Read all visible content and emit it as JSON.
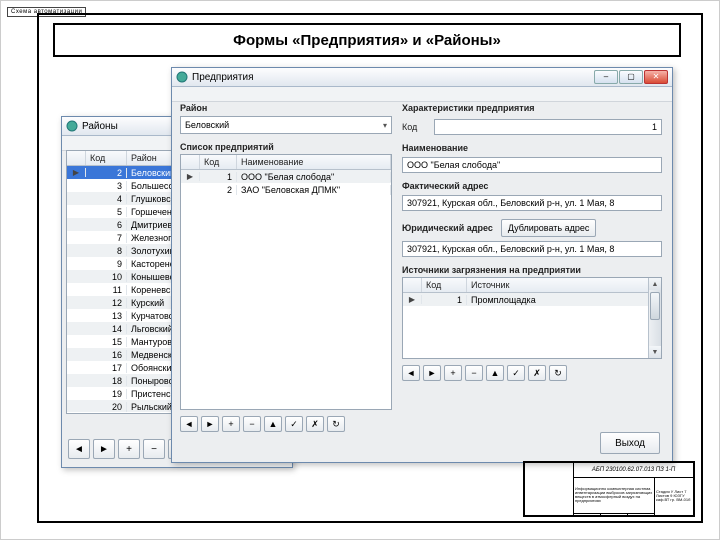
{
  "tag_text": "Схема автоматизации",
  "page_title": "Формы «Предприятия» и «Районы»",
  "window_districts": {
    "title": "Районы",
    "columns": [
      "Код",
      "Район"
    ],
    "rows": [
      {
        "code": 2,
        "name": "Беловский",
        "selected": true
      },
      {
        "code": 3,
        "name": "Большесолдатский"
      },
      {
        "code": 4,
        "name": "Глушковский"
      },
      {
        "code": 5,
        "name": "Горшеченский"
      },
      {
        "code": 6,
        "name": "Дмитриевский"
      },
      {
        "code": 7,
        "name": "Железногорский"
      },
      {
        "code": 8,
        "name": "Золотухинский"
      },
      {
        "code": 9,
        "name": "Касторенский"
      },
      {
        "code": 10,
        "name": "Конышевский"
      },
      {
        "code": 11,
        "name": "Кореневский"
      },
      {
        "code": 12,
        "name": "Курский"
      },
      {
        "code": 13,
        "name": "Курчатовский"
      },
      {
        "code": 14,
        "name": "Льговский"
      },
      {
        "code": 15,
        "name": "Мантуровский"
      },
      {
        "code": 16,
        "name": "Медвенский"
      },
      {
        "code": 17,
        "name": "Обоянский"
      },
      {
        "code": 18,
        "name": "Поныровский"
      },
      {
        "code": 19,
        "name": "Пристенский"
      },
      {
        "code": 20,
        "name": "Рыльский"
      }
    ],
    "nav_icons": [
      "◄",
      "►",
      "+",
      "−",
      "▲",
      "✓",
      "✗",
      "↻"
    ],
    "exit_label": "Выход"
  },
  "window_enterprises": {
    "title": "Предприятия",
    "label_district": "Район",
    "district_value": "Беловский",
    "label_list": "Список предприятий",
    "list_columns": [
      "Код",
      "Наименование"
    ],
    "list_rows": [
      {
        "code": 1,
        "name": "ООО \"Белая слобода\""
      },
      {
        "code": 2,
        "name": "ЗАО \"Беловская ДПМК\""
      }
    ],
    "label_props": "Характеристики предприятия",
    "label_code": "Код",
    "code_value": "1",
    "label_name": "Наименование",
    "name_value": "ООО \"Белая слобода\"",
    "label_fact": "Фактический адрес",
    "fact_value": "307921, Курская обл., Беловский р-н, ул. 1 Мая, 8",
    "label_legal": "Юридический адрес",
    "dup_label": "Дублировать адрес",
    "legal_value": "307921, Курская обл., Беловский р-н, ул. 1 Мая, 8",
    "label_sources": "Источники загрязнения на предприятии",
    "sources_columns": [
      "Код",
      "Источник"
    ],
    "sources_rows": [
      {
        "code": 1,
        "name": "Промплощадка"
      }
    ],
    "nav_icons": [
      "◄",
      "►",
      "+",
      "−",
      "▲",
      "✓",
      "✗",
      "↻"
    ],
    "exit_label": "Выход"
  },
  "stamp": {
    "line1": "АБП 230100.62.07.013 ПЗ 1-П",
    "line2": "Информационно компьютерная система инвентаризации выбросов загрязняющих веществ в атмосферный воздух на предприятиях",
    "line3": "Стадия У  Лист 7  Листов 9  ЮЗГУ каф.ВТ  гр. ВМ-01б"
  }
}
